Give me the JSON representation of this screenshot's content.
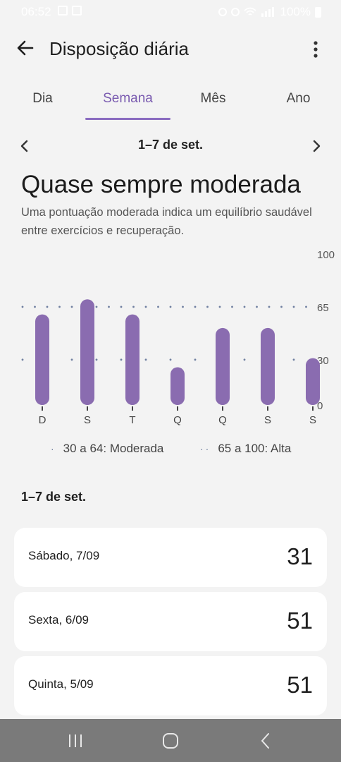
{
  "status_bar": {
    "time": "06:52",
    "battery": "100%"
  },
  "app_bar": {
    "title": "Disposição diária"
  },
  "tabs": [
    {
      "label": "Dia",
      "active": false
    },
    {
      "label": "Semana",
      "active": true
    },
    {
      "label": "Mês",
      "active": false
    },
    {
      "label": "Ano",
      "active": false
    }
  ],
  "week_nav": {
    "label": "1–7 de set."
  },
  "summary": {
    "headline": "Quase sempre moderada",
    "description": "Uma pontuação moderada indica um equilíbrio saudável entre exercícios e recuperação."
  },
  "chart_data": {
    "type": "bar",
    "categories": [
      "D",
      "S",
      "T",
      "Q",
      "Q",
      "S",
      "S"
    ],
    "values": [
      60,
      70,
      60,
      25,
      51,
      51,
      31
    ],
    "ylim": [
      0,
      100
    ],
    "y_ticks": [
      0,
      30,
      65,
      100
    ],
    "reference_lines": [
      30,
      65
    ],
    "bar_color": "#8a6cb0",
    "legend_position": "bottom"
  },
  "legend": {
    "moderate": "30 a 64: Moderada",
    "high": "65 a 100: Alta"
  },
  "list": {
    "title": "1–7 de set.",
    "items": [
      {
        "day": "Sábado, 7/09",
        "score": "31"
      },
      {
        "day": "Sexta, 6/09",
        "score": "51"
      },
      {
        "day": "Quinta, 5/09",
        "score": "51"
      }
    ]
  },
  "colors": {
    "accent": "#8a6cb0",
    "background": "#f3f3f3",
    "card": "#ffffff"
  }
}
